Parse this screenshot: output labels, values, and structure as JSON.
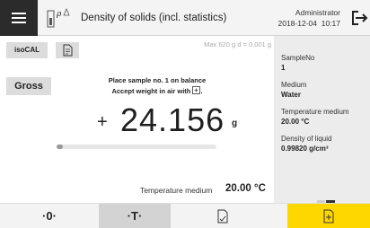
{
  "header": {
    "title": "Density of solids (incl. statistics)",
    "app_icon": "balance-density-icon",
    "app_icon_letter": "ρ",
    "user": "Administrator",
    "date": "2018-12-04",
    "time": "10:17",
    "menu_icon": "hamburger-menu-icon",
    "logout_icon": "logout-icon"
  },
  "toolbar": {
    "isocal_label": "isoCAL",
    "doc_icon": "document-icon"
  },
  "main": {
    "range_info": "Max 620 g   d = 0.001 g",
    "gross_label": "Gross",
    "instruction_line1": "Place sample no. 1 on balance",
    "instruction_line2": "Accept weight in air with",
    "instruction_icon": "accept-icon",
    "sign": "+",
    "weight_value": "24.156",
    "unit": "g",
    "progress": 0.0,
    "temperature_label": "Temperature medium",
    "temperature_value": "20.00 °C"
  },
  "info_panel": {
    "items": [
      {
        "label": "SampleNo",
        "value": "1"
      },
      {
        "label": "Medium",
        "value": "Water"
      },
      {
        "label": "Temperature medium",
        "value": "20.00 °C"
      },
      {
        "label": "Density of liquid",
        "value": "0.99820 g/cm³"
      }
    ]
  },
  "bottom_bar": {
    "zero_label": "·0·",
    "tare_label": "·T·",
    "print_icon": "print-icon",
    "add_icon": "add-to-record-icon"
  },
  "colors": {
    "header_bg": "#f4f4f4",
    "menu_bg": "#2b2b2b",
    "accent_yellow": "#ffd700",
    "panel_bg": "#ececec"
  }
}
